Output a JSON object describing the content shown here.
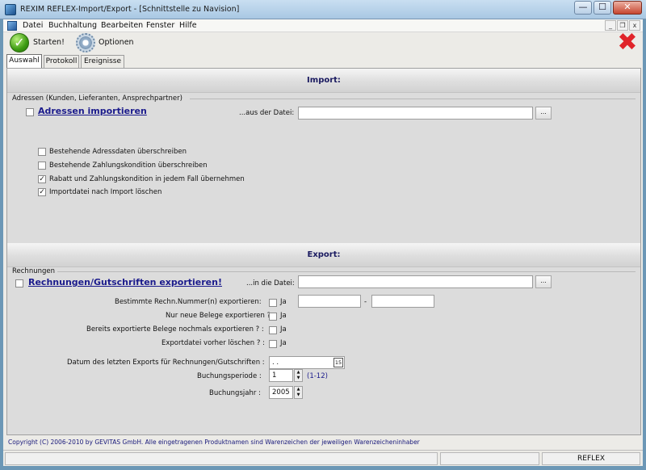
{
  "window": {
    "title": "REXIM REFLEX-Import/Export - [Schnittstelle zu Navision]",
    "minimize": "—",
    "maximize": "☐",
    "close": "✕"
  },
  "menu": {
    "items": [
      {
        "label": "Datei"
      },
      {
        "label": "Buchhaltung"
      },
      {
        "label": "Bearbeiten"
      },
      {
        "label": "Fenster"
      },
      {
        "label": "Hilfe"
      }
    ],
    "mdi_min": "_",
    "mdi_restore": "❐",
    "mdi_close": "x"
  },
  "toolbar": {
    "start_label": "Starten!",
    "start_glyph": "✓",
    "options_label": "Optionen",
    "exit_glyph": "✖"
  },
  "tabs": [
    {
      "label": "Auswahl"
    },
    {
      "label": "Protokoll"
    },
    {
      "label": "Ereignisse"
    }
  ],
  "import": {
    "header": "Import:",
    "group_label": "Adressen (Kunden, Lieferanten, Ansprechpartner)",
    "main_checkbox": "Adressen importieren",
    "main_checked": false,
    "file_label": "...aus der Datei:",
    "file_value": "",
    "browse": "...",
    "options": [
      {
        "label": "Bestehende Adressdaten überschreiben",
        "checked": false
      },
      {
        "label": "Bestehende Zahlungskondition überschreiben",
        "checked": false
      },
      {
        "label": "Rabatt und Zahlungskondition in jedem Fall übernehmen",
        "checked": true
      },
      {
        "label": "Importdatei nach Import löschen",
        "checked": true
      }
    ]
  },
  "export": {
    "header": "Export:",
    "group_label": "Rechnungen",
    "main_checkbox": "Rechnungen/Gutschriften exportieren!",
    "main_checked": false,
    "file_label": "...in die Datei:",
    "file_value": "",
    "browse": "...",
    "rows": [
      {
        "label": "Bestimmte Rechn.Nummer(n) exportieren:",
        "ja": "Ja",
        "checked": false
      },
      {
        "label": "Nur neue Belege exportieren ? :",
        "ja": "Ja",
        "checked": false
      },
      {
        "label": "Bereits exportierte Belege nochmals exportieren ? :",
        "ja": "Ja",
        "checked": false
      },
      {
        "label": "Exportdatei vorher löschen ? :",
        "ja": "Ja",
        "checked": false
      }
    ],
    "range_from": "",
    "range_sep": "-",
    "range_to": "",
    "last_export_label": "Datum des letzten Exports für Rechnungen/Gutschriften :",
    "last_export_value": ". .",
    "calendar_glyph": "15",
    "period_label": "Buchungsperiode :",
    "period_value": "1",
    "period_hint": "(1-12)",
    "year_label": "Buchungsjahr :",
    "year_value": "2005",
    "spin_up": "▲",
    "spin_down": "▼"
  },
  "copyright": "Copyright (C) 2006-2010 by GEVITAS GmbH. Alle eingetragenen Produktnamen sind Warenzeichen der jeweiligen Warenzeicheninhaber",
  "status": {
    "app": "REFLEX"
  }
}
